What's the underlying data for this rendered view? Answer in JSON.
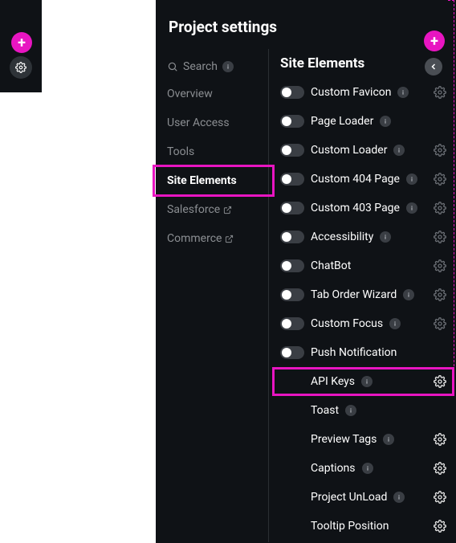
{
  "panel": {
    "title": "Project settings"
  },
  "search": {
    "placeholder": "Search"
  },
  "nav": {
    "items": [
      {
        "label": "Overview"
      },
      {
        "label": "User Access"
      },
      {
        "label": "Tools"
      },
      {
        "label": "Site Elements"
      },
      {
        "label": "Salesforce"
      },
      {
        "label": "Commerce"
      }
    ]
  },
  "content": {
    "title": "Site Elements",
    "elements": [
      {
        "label": "Custom Favicon"
      },
      {
        "label": "Page Loader"
      },
      {
        "label": "Custom Loader"
      },
      {
        "label": "Custom 404 Page"
      },
      {
        "label": "Custom 403 Page"
      },
      {
        "label": "Accessibility"
      },
      {
        "label": "ChatBot"
      },
      {
        "label": "Tab Order Wizard"
      },
      {
        "label": "Custom Focus"
      },
      {
        "label": "Push Notification"
      },
      {
        "label": "API Keys"
      },
      {
        "label": "Toast"
      },
      {
        "label": "Preview Tags"
      },
      {
        "label": "Captions"
      },
      {
        "label": "Project UnLoad"
      },
      {
        "label": "Tooltip Position"
      }
    ]
  }
}
